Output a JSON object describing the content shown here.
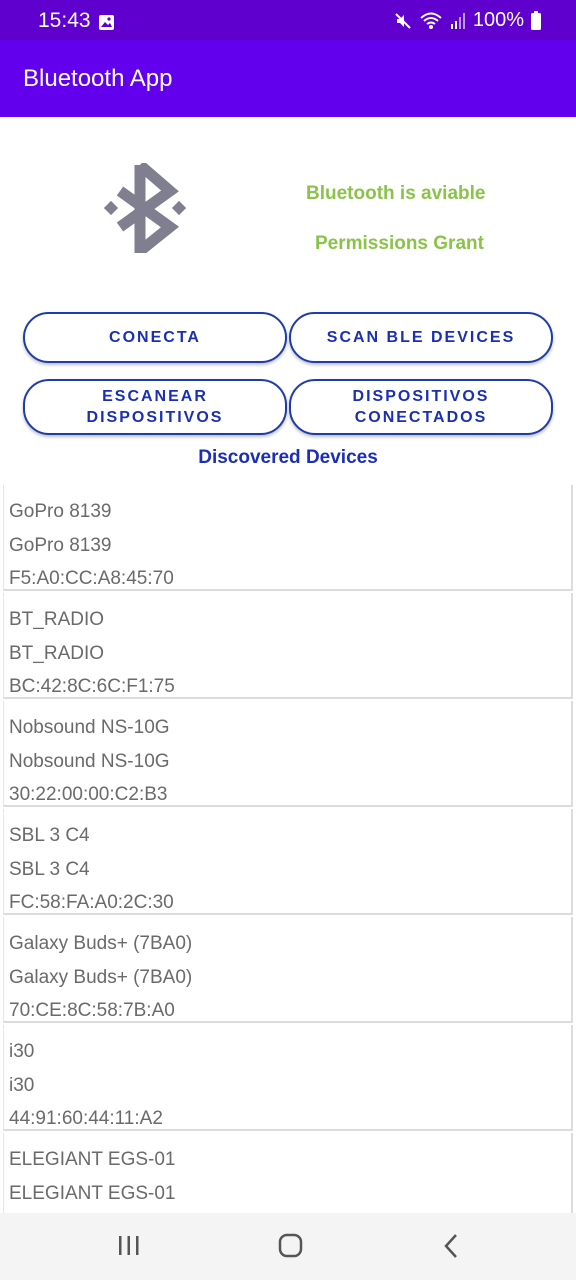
{
  "status_bar": {
    "time": "15:43",
    "battery": "100%",
    "icons": [
      "gallery-icon",
      "mute-icon",
      "wifi-icon",
      "signal-icon",
      "battery-icon"
    ]
  },
  "app_bar": {
    "title": "Bluetooth App"
  },
  "header": {
    "logo_icon": "bluetooth-icon",
    "bluetooth_status": "Bluetooth is aviable",
    "permission_status": "Permissions Grant",
    "status_color": "#8bc34a"
  },
  "buttons": {
    "connect": "CONECTA",
    "scan_ble": "SCAN BLE DEVICES",
    "scan_devices": "ESCANEAR\nDISPOSITIVOS",
    "connected_devices": "DISPOSITIVOS\nCONECTADOS"
  },
  "section_title": "Discovered Devices",
  "devices": [
    {
      "name": "GoPro 8139",
      "alias": "GoPro 8139",
      "address": "F5:A0:CC:A8:45:70"
    },
    {
      "name": "BT_RADIO",
      "alias": "BT_RADIO",
      "address": "BC:42:8C:6C:F1:75"
    },
    {
      "name": "Nobsound NS-10G",
      "alias": "Nobsound NS-10G",
      "address": "30:22:00:00:C2:B3"
    },
    {
      "name": "SBL 3 C4",
      "alias": "SBL 3 C4",
      "address": "FC:58:FA:A0:2C:30"
    },
    {
      "name": "Galaxy Buds+ (7BA0)",
      "alias": "Galaxy Buds+ (7BA0)",
      "address": "70:CE:8C:58:7B:A0"
    },
    {
      "name": "i30",
      "alias": "i30",
      "address": "44:91:60:44:11:A2"
    },
    {
      "name": "ELEGIANT EGS-01",
      "alias": "ELEGIANT EGS-01",
      "address": ""
    }
  ],
  "nav_bar": {
    "icons": [
      "recents-icon",
      "home-icon",
      "back-icon"
    ]
  },
  "colors": {
    "primary": "#6200ee",
    "status_bar": "#5f00cf",
    "button_text": "#1a2fb5"
  }
}
